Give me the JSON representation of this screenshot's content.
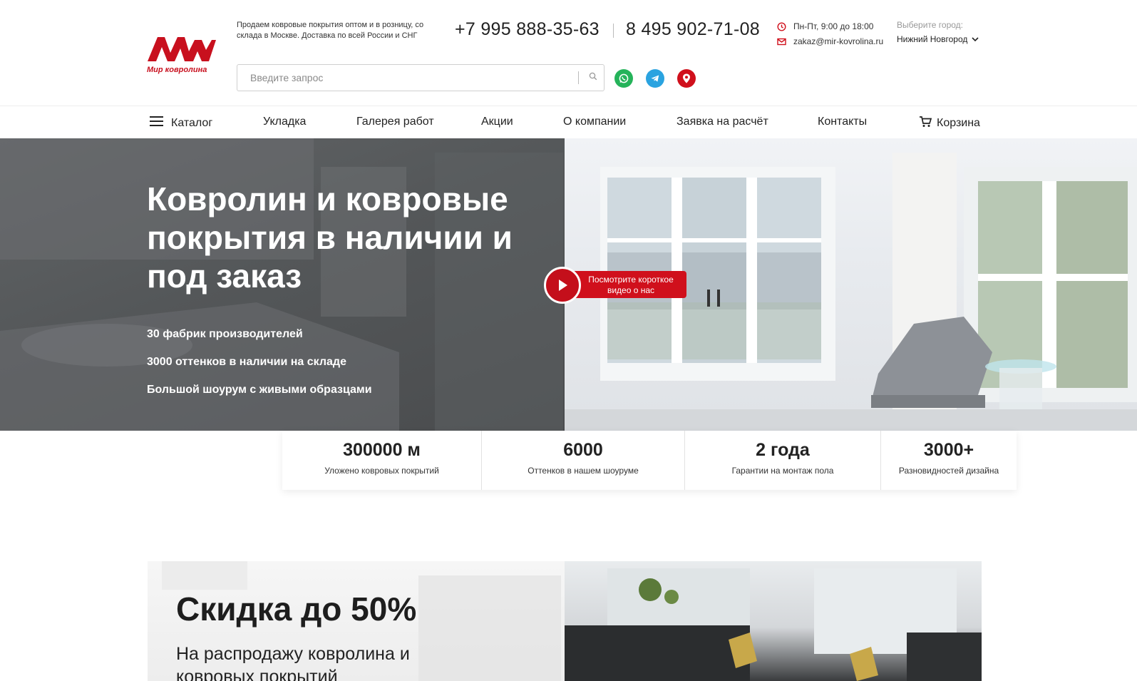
{
  "header": {
    "logo_text": "Мир ковролина",
    "tagline": "Продаем ковровые покрытия оптом и в розницу, со склада в Москве. Доставка по всей России и СНГ",
    "phone1": "+7 995 888-35-63",
    "phone2": "8 495 902-71-08",
    "hours": "Пн-Пт, 9:00 до 18:00",
    "email": "zakaz@mir-kovrolina.ru",
    "city_label": "Выберите город:",
    "city_value": "Нижний Новгород",
    "search_placeholder": "Введите запрос",
    "social": [
      "whatsapp-icon",
      "telegram-icon",
      "map-pin-icon"
    ]
  },
  "nav": {
    "catalog": "Каталог",
    "items": [
      "Укладка",
      "Галерея работ",
      "Акции",
      "О компании",
      "Заявка на расчёт",
      "Контакты"
    ],
    "cart": "Корзина"
  },
  "hero": {
    "title": "Ковролин и ковровые покрытия в наличии и под заказ",
    "bullets": [
      "30 фабрик производителей",
      "3000 оттенков в наличии на складе",
      "Большой шоурум с живыми образцами"
    ],
    "video_label": "Посмотрите короткое видео о нас"
  },
  "stats": [
    {
      "value": "300000 м",
      "label": "Уложено ковровых покрытий"
    },
    {
      "value": "6000",
      "label": "Оттенков в нашем шоуруме"
    },
    {
      "value": "2 года",
      "label": "Гарантии на монтаж пола"
    },
    {
      "value": "3000+",
      "label": "Разновидностей дизайна"
    }
  ],
  "promo": {
    "title": "Скидка до 50%",
    "subtitle": "На распродажу ковролина и ковровых покрытий"
  },
  "colors": {
    "brand_red": "#d0101c",
    "whatsapp_green": "#25b35a",
    "telegram_blue": "#2aa3e0",
    "hero_overlay": "#555759"
  }
}
